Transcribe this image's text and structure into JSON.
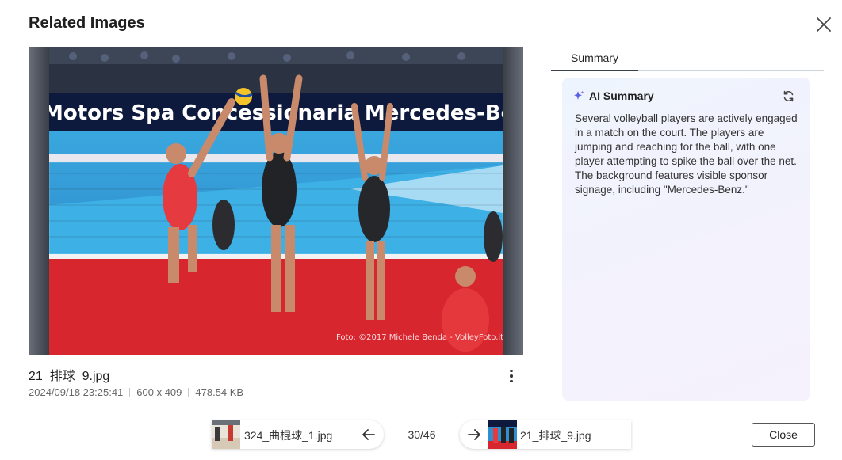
{
  "dialog": {
    "title": "Related Images",
    "close_button": "Close"
  },
  "image": {
    "file_name": "21_排球_9.jpg",
    "date": "2024/09/18 23:25:41",
    "dimensions": "600 x 409",
    "size": "478.54 KB",
    "photo_banner": "Motors Spa  Concessionaria Mercedes-Benz",
    "photo_credit": "Foto: ©2017 Michele Benda - VolleyFoto.it"
  },
  "tabs": [
    {
      "label": "Summary",
      "active": true
    }
  ],
  "summary": {
    "title": "AI Summary",
    "text": "Several volleyball players are actively engaged in a match on the court. The players are jumping and reaching for the ball, with one player attempting to spike the ball over the net. The background features visible sponsor signage, including \"Mercedes-Benz.\""
  },
  "navigation": {
    "prev_label": "324_曲棍球_1.jpg",
    "next_label": "21_排球_9.jpg",
    "position": "30/46"
  },
  "icons": {
    "close": "close-icon",
    "more": "more-vertical-icon",
    "sparkle": "sparkle-icon",
    "refresh": "refresh-icon",
    "arrow_left": "arrow-left-icon",
    "arrow_right": "arrow-right-icon"
  },
  "colors": {
    "accent_tab_underline": "#3a3f4a",
    "summary_bg": "#f1f3fd",
    "sparkle": "#5b5ee8"
  }
}
